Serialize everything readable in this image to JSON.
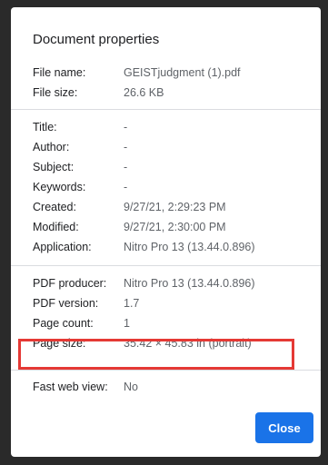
{
  "dialog": {
    "title": "Document properties",
    "close_label": "Close"
  },
  "file": {
    "name_label": "File name:",
    "name_value": "GEISTjudgment (1).pdf",
    "size_label": "File size:",
    "size_value": "26.6 KB"
  },
  "meta": {
    "title_label": "Title:",
    "title_value": "-",
    "author_label": "Author:",
    "author_value": "-",
    "subject_label": "Subject:",
    "subject_value": "-",
    "keywords_label": "Keywords:",
    "keywords_value": "-",
    "created_label": "Created:",
    "created_value": "9/27/21, 2:29:23 PM",
    "modified_label": "Modified:",
    "modified_value": "9/27/21, 2:30:00 PM",
    "application_label": "Application:",
    "application_value": "Nitro Pro 13 (13.44.0.896)"
  },
  "pdf": {
    "producer_label": "PDF producer:",
    "producer_value": "Nitro Pro 13 (13.44.0.896)",
    "version_label": "PDF version:",
    "version_value": "1.7",
    "page_count_label": "Page count:",
    "page_count_value": "1",
    "page_size_label": "Page size:",
    "page_size_value": "35.42 × 45.83 in (portrait)"
  },
  "web": {
    "fast_web_view_label": "Fast web view:",
    "fast_web_view_value": "No"
  },
  "colors": {
    "primary_button": "#1a73e8",
    "highlight_border": "#e53935"
  }
}
